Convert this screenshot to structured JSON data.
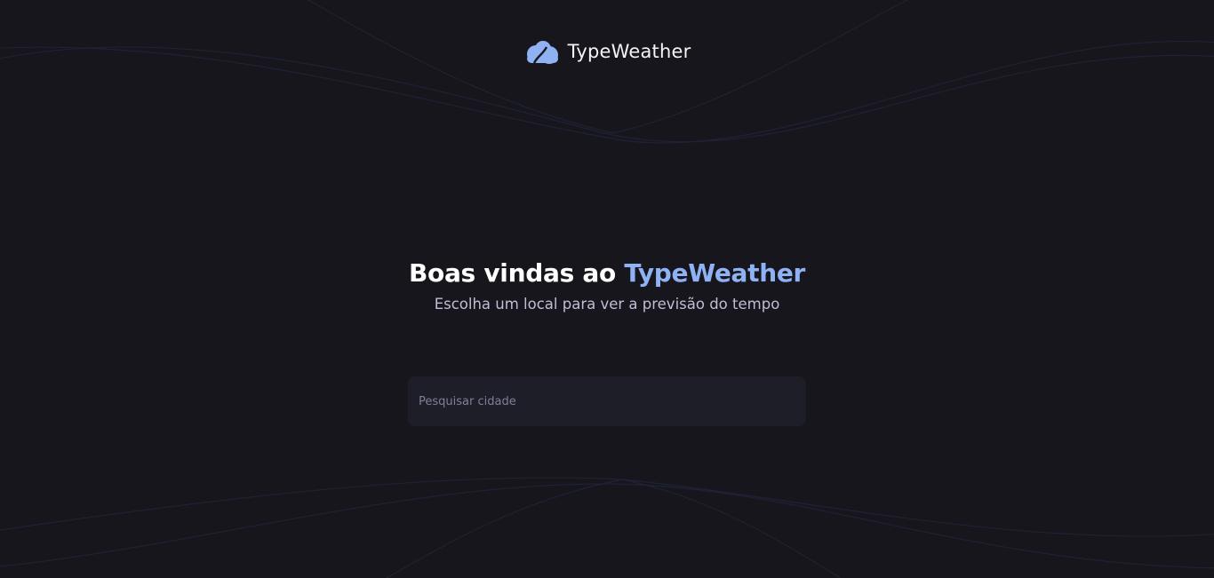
{
  "colors": {
    "background": "#16161c",
    "accent": "#8fb2f5",
    "input_background": "#1e1e29",
    "wave_lines": "#1f2236"
  },
  "header": {
    "logo_icon": "cloud-icon",
    "brand_name": "TypeWeather"
  },
  "hero": {
    "title_prefix": "Boas vindas ao ",
    "title_accent": "TypeWeather",
    "subtitle": "Escolha um local para ver a previsão do tempo"
  },
  "search": {
    "placeholder": "Pesquisar cidade",
    "value": ""
  }
}
